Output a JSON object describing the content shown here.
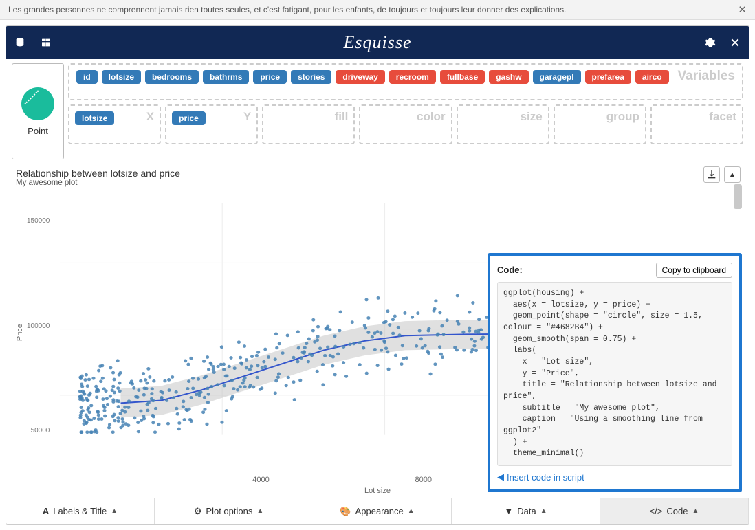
{
  "quote_bar": {
    "text": "Les grandes personnes ne comprennent jamais rien toutes seules, et c'est fatigant, pour les enfants, de toujours et toujours leur donner des explications."
  },
  "app_title": "Esquisse",
  "geom": {
    "label": "Point"
  },
  "variables_label": "Variables",
  "variables": [
    {
      "name": "id",
      "cls": "pill-blue"
    },
    {
      "name": "lotsize",
      "cls": "pill-blue"
    },
    {
      "name": "bedrooms",
      "cls": "pill-blue"
    },
    {
      "name": "bathrms",
      "cls": "pill-blue"
    },
    {
      "name": "price",
      "cls": "pill-blue"
    },
    {
      "name": "stories",
      "cls": "pill-blue"
    },
    {
      "name": "driveway",
      "cls": "pill-orange"
    },
    {
      "name": "recroom",
      "cls": "pill-orange"
    },
    {
      "name": "fullbase",
      "cls": "pill-orange"
    },
    {
      "name": "gashw",
      "cls": "pill-orange"
    },
    {
      "name": "garagepl",
      "cls": "pill-blue"
    },
    {
      "name": "prefarea",
      "cls": "pill-orange"
    },
    {
      "name": "airco",
      "cls": "pill-orange"
    }
  ],
  "dropzones": {
    "x": {
      "label": "X",
      "pill": "lotsize"
    },
    "y": {
      "label": "Y",
      "pill": "price"
    },
    "fill": {
      "label": "fill"
    },
    "color": {
      "label": "color"
    },
    "size": {
      "label": "size"
    },
    "group": {
      "label": "group"
    },
    "facet": {
      "label": "facet"
    }
  },
  "plot": {
    "title": "Relationship between lotsize and price",
    "subtitle": "My awesome plot",
    "ylabel": "Price",
    "xlabel": "Lot size"
  },
  "code_panel": {
    "heading": "Code:",
    "copy_btn": "Copy to clipboard",
    "code": "ggplot(housing) +\n  aes(x = lotsize, y = price) +\n  geom_point(shape = \"circle\", size = 1.5, colour = \"#4682B4\") +\n  geom_smooth(span = 0.75) +\n  labs(\n    x = \"Lot size\",\n    y = \"Price\",\n    title = \"Relationship between lotsize and price\",\n    subtitle = \"My awesome plot\",\n    caption = \"Using a smoothing line from ggplot2\"\n  ) +\n  theme_minimal()",
    "insert": "Insert code in script"
  },
  "bottom_tabs": {
    "labels": "Labels & Title",
    "plotopt": "Plot options",
    "appearance": "Appearance",
    "data": "Data",
    "code": "Code"
  },
  "chart_data": {
    "type": "scatter",
    "title": "Relationship between lotsize and price",
    "subtitle": "My awesome plot",
    "xlabel": "Lot size",
    "ylabel": "Price",
    "xlim": [
      0,
      16500
    ],
    "ylim": [
      20000,
      195000
    ],
    "xticks": [
      4000,
      8000
    ],
    "yticks": [
      50000,
      100000,
      150000
    ],
    "smooth_line": [
      {
        "x": 1500,
        "y": 44000
      },
      {
        "x": 2500,
        "y": 46000
      },
      {
        "x": 3500,
        "y": 54000
      },
      {
        "x": 4500,
        "y": 64000
      },
      {
        "x": 5500,
        "y": 74000
      },
      {
        "x": 6500,
        "y": 84000
      },
      {
        "x": 7500,
        "y": 91000
      },
      {
        "x": 8500,
        "y": 95000
      },
      {
        "x": 10000,
        "y": 96000
      },
      {
        "x": 12000,
        "y": 96500
      },
      {
        "x": 16000,
        "y": 97000
      }
    ],
    "smooth_band_halfwidth": 11000,
    "n_points_estimate": 540,
    "point_color": "#4682B4"
  }
}
